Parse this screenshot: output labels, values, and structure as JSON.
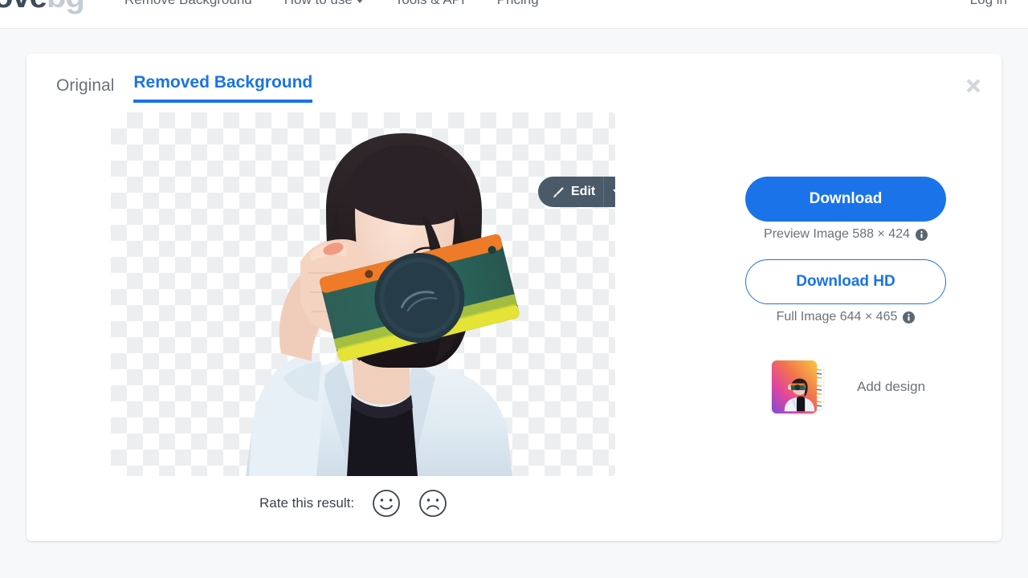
{
  "header": {
    "logo": {
      "dark_part": "ove",
      "light_part": "bg"
    },
    "nav": [
      {
        "label": "Remove Background",
        "has_caret": false
      },
      {
        "label": "How to use",
        "has_caret": true
      },
      {
        "label": "Tools & API",
        "has_caret": false
      },
      {
        "label": "Pricing",
        "has_caret": false
      }
    ],
    "login_label": "Log in"
  },
  "card": {
    "tabs": [
      {
        "label": "Original",
        "active": false
      },
      {
        "label": "Removed Background",
        "active": true
      }
    ],
    "close_icon": "close-icon",
    "edit_button": {
      "label": "Edit",
      "icon": "paintbrush-icon",
      "caret": "chevron-down-icon"
    },
    "rate": {
      "label": "Rate this result:",
      "positive_icon": "smiley-face-icon",
      "negative_icon": "frowny-face-icon"
    }
  },
  "right_panel": {
    "download": {
      "label": "Download",
      "caption": "Preview Image 588 × 424",
      "caption_info_icon": "info-icon"
    },
    "download_hd": {
      "label": "Download HD",
      "caption": "Full Image 644 × 465",
      "caption_info_icon": "info-icon"
    },
    "add_design": {
      "label": "Add design",
      "thumbnail_icon": "design-thumbnail-stack-icon"
    }
  },
  "colors": {
    "accent_blue": "#1a73e8",
    "page_background": "#f7f8fa",
    "card_background": "#ffffff",
    "edit_button": "#4a5a68",
    "muted_text": "#6a7279",
    "checker_light": "#ffffff",
    "checker_dark": "#eceef0"
  }
}
